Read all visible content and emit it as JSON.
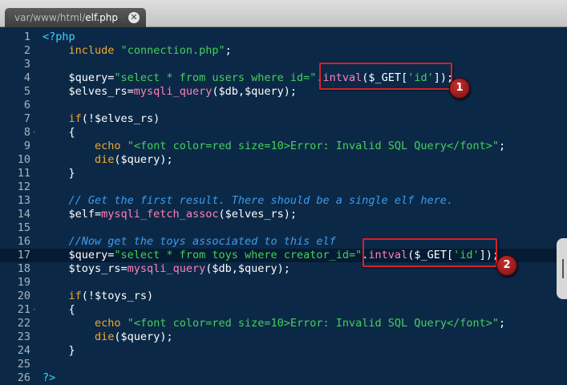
{
  "tab": {
    "path": "var/www/html/",
    "filename": "elf.php",
    "close_glyph": "✕"
  },
  "code": [
    {
      "n": "1",
      "tokens": [
        {
          "t": "<?php",
          "c": "ph"
        }
      ]
    },
    {
      "n": "2",
      "tokens": [
        {
          "t": "    "
        },
        {
          "t": "include",
          "c": "kw"
        },
        {
          "t": " "
        },
        {
          "t": "\"connection.php\"",
          "c": "str"
        },
        {
          "t": ";"
        }
      ]
    },
    {
      "n": "3",
      "tokens": []
    },
    {
      "n": "4",
      "tokens": [
        {
          "t": "    $query="
        },
        {
          "t": "\"select * from users where id=\"",
          "c": "str"
        },
        {
          "t": "."
        },
        {
          "t": "intval",
          "c": "fn"
        },
        {
          "t": "($_GET["
        },
        {
          "t": "'id'",
          "c": "str"
        },
        {
          "t": "]);"
        }
      ]
    },
    {
      "n": "5",
      "tokens": [
        {
          "t": "    $elves_rs="
        },
        {
          "t": "mysqli_query",
          "c": "fn"
        },
        {
          "t": "($db,$query);"
        }
      ]
    },
    {
      "n": "6",
      "tokens": []
    },
    {
      "n": "7",
      "tokens": [
        {
          "t": "    "
        },
        {
          "t": "if",
          "c": "kw"
        },
        {
          "t": "(!$elves_rs)"
        }
      ]
    },
    {
      "n": "8",
      "fold": true,
      "tokens": [
        {
          "t": "    {"
        }
      ]
    },
    {
      "n": "9",
      "tokens": [
        {
          "t": "        "
        },
        {
          "t": "echo",
          "c": "kw"
        },
        {
          "t": " "
        },
        {
          "t": "\"<font color=red size=10>Error: Invalid SQL Query</font>\"",
          "c": "str"
        },
        {
          "t": ";"
        }
      ]
    },
    {
      "n": "10",
      "tokens": [
        {
          "t": "        "
        },
        {
          "t": "die",
          "c": "kw"
        },
        {
          "t": "($query);"
        }
      ]
    },
    {
      "n": "11",
      "tokens": [
        {
          "t": "    }"
        }
      ]
    },
    {
      "n": "12",
      "tokens": []
    },
    {
      "n": "13",
      "tokens": [
        {
          "t": "    "
        },
        {
          "t": "// Get the first result. There should be a single elf here.",
          "c": "cm"
        }
      ]
    },
    {
      "n": "14",
      "tokens": [
        {
          "t": "    $elf="
        },
        {
          "t": "mysqli_fetch_assoc",
          "c": "fn"
        },
        {
          "t": "($elves_rs);"
        }
      ]
    },
    {
      "n": "15",
      "tokens": []
    },
    {
      "n": "16",
      "tokens": [
        {
          "t": "    "
        },
        {
          "t": "//Now get the toys associated to this elf",
          "c": "cm"
        }
      ]
    },
    {
      "n": "17",
      "active": true,
      "tokens": [
        {
          "t": "    $query="
        },
        {
          "t": "\"select * from toys where creator_id=\"",
          "c": "str"
        },
        {
          "t": "."
        },
        {
          "t": "intval",
          "c": "fn"
        },
        {
          "t": "($_GET["
        },
        {
          "t": "'id'",
          "c": "str"
        },
        {
          "t": "]);"
        }
      ]
    },
    {
      "n": "18",
      "tokens": [
        {
          "t": "    $toys_rs="
        },
        {
          "t": "mysqli_query",
          "c": "fn"
        },
        {
          "t": "($db,$query);"
        }
      ]
    },
    {
      "n": "19",
      "tokens": []
    },
    {
      "n": "20",
      "tokens": [
        {
          "t": "    "
        },
        {
          "t": "if",
          "c": "kw"
        },
        {
          "t": "(!$toys_rs)"
        }
      ]
    },
    {
      "n": "21",
      "fold": true,
      "tokens": [
        {
          "t": "    {"
        }
      ]
    },
    {
      "n": "22",
      "tokens": [
        {
          "t": "        "
        },
        {
          "t": "echo",
          "c": "kw"
        },
        {
          "t": " "
        },
        {
          "t": "\"<font color=red size=10>Error: Invalid SQL Query</font>\"",
          "c": "str"
        },
        {
          "t": ";"
        }
      ]
    },
    {
      "n": "23",
      "tokens": [
        {
          "t": "        "
        },
        {
          "t": "die",
          "c": "kw"
        },
        {
          "t": "($query);"
        }
      ]
    },
    {
      "n": "24",
      "tokens": [
        {
          "t": "    }"
        }
      ]
    },
    {
      "n": "25",
      "tokens": []
    },
    {
      "n": "26",
      "tokens": [
        {
          "t": "?>",
          "c": "ph"
        }
      ]
    }
  ],
  "annotations": [
    {
      "label": "1",
      "line": "4"
    },
    {
      "label": "2",
      "line": "17"
    }
  ],
  "colors": {
    "background": "#0b2947",
    "keyword": "#f0a830",
    "string": "#45d05a",
    "function": "#ff80b8",
    "php_tag": "#40d0ff",
    "comment": "#3e9bef",
    "annotation": "#d8202a"
  }
}
